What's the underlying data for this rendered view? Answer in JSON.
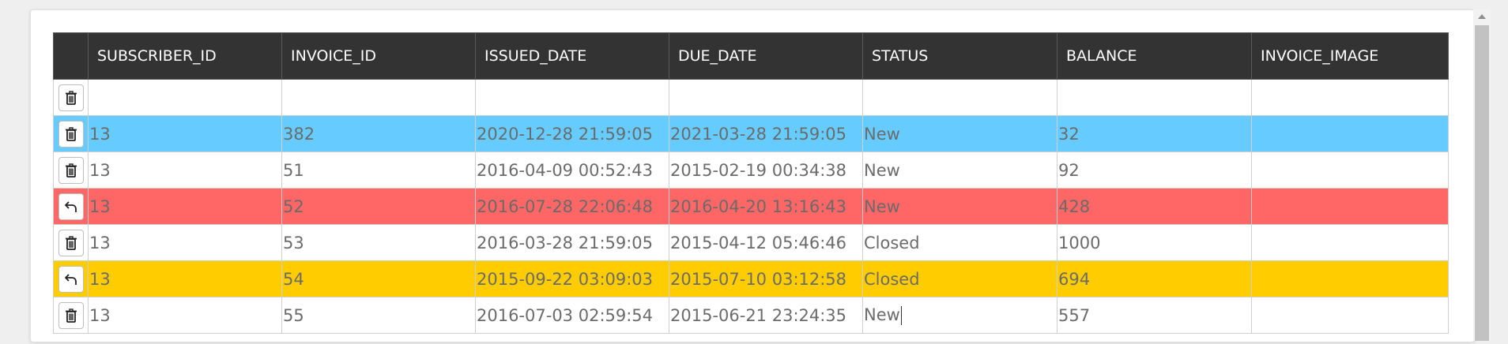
{
  "table": {
    "columns": [
      "",
      "SUBSCRIBER_ID",
      "INVOICE_ID",
      "ISSUED_DATE",
      "DUE_DATE",
      "STATUS",
      "BALANCE",
      "INVOICE_IMAGE"
    ],
    "rows": [
      {
        "state": "empty",
        "action_icon": "trash-icon",
        "cells": [
          "",
          "",
          "",
          "",
          "",
          "",
          ""
        ]
      },
      {
        "state": "new",
        "action_icon": "trash-icon",
        "cells": [
          "13",
          "382",
          "2020-12-28 21:59:05",
          "2021-03-28 21:59:05",
          "New",
          "32",
          ""
        ]
      },
      {
        "state": "normal",
        "action_icon": "trash-icon",
        "cells": [
          "13",
          "51",
          "2016-04-09 00:52:43",
          "2015-02-19 00:34:38",
          "New",
          "92",
          ""
        ]
      },
      {
        "state": "deleted",
        "action_icon": "undo-icon",
        "cells": [
          "13",
          "52",
          "2016-07-28 22:06:48",
          "2016-04-20 13:16:43",
          "New",
          "428",
          ""
        ]
      },
      {
        "state": "normal",
        "action_icon": "trash-icon",
        "cells": [
          "13",
          "53",
          "2016-03-28 21:59:05",
          "2015-04-12 05:46:46",
          "Closed",
          "1000",
          ""
        ]
      },
      {
        "state": "edited",
        "action_icon": "undo-icon",
        "cells": [
          "13",
          "54",
          "2015-09-22 03:09:03",
          "2015-07-10 03:12:58",
          "Closed",
          "694",
          ""
        ]
      },
      {
        "state": "normal",
        "action_icon": "trash-icon",
        "cells": [
          "13",
          "55",
          "2016-07-03 02:59:54",
          "2015-06-21 23:24:35",
          "New",
          "557",
          ""
        ]
      }
    ]
  },
  "colors": {
    "header_bg": "#333333",
    "new_row": "#66ccff",
    "deleted_row": "#ff6666",
    "edited_row": "#ffcc00"
  }
}
